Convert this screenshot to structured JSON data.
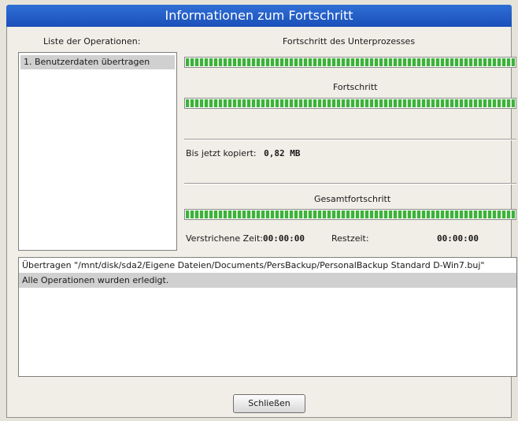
{
  "window": {
    "title": "Informationen zum Fortschritt"
  },
  "operations": {
    "label": "Liste der Operationen:",
    "items": [
      "1. Benutzerdaten übertragen"
    ]
  },
  "subprocess": {
    "label": "Fortschritt des Unterprozesses",
    "progress": 1.0
  },
  "progress": {
    "label": "Fortschritt",
    "value": 1.0
  },
  "copied": {
    "label": "Bis jetzt kopiert:",
    "value": "0,82 MB"
  },
  "total": {
    "label": "Gesamtfortschritt",
    "progress": 1.0,
    "elapsed_label": "Verstrichene Zeit:",
    "elapsed_value": "00:00:00",
    "remaining_label": "Restzeit:",
    "remaining_value": "00:00:00"
  },
  "log": {
    "lines": [
      "Übertragen \"/mnt/disk/sda2/Eigene Dateien/Documents/PersBackup/PersonalBackup Standard D-Win7.buj\"",
      "Alle Operationen wurden erledigt."
    ]
  },
  "buttons": {
    "close": "Schließen"
  },
  "colors": {
    "title_bar": "#1f5cc4",
    "progress_fill": "#3cb13c"
  }
}
